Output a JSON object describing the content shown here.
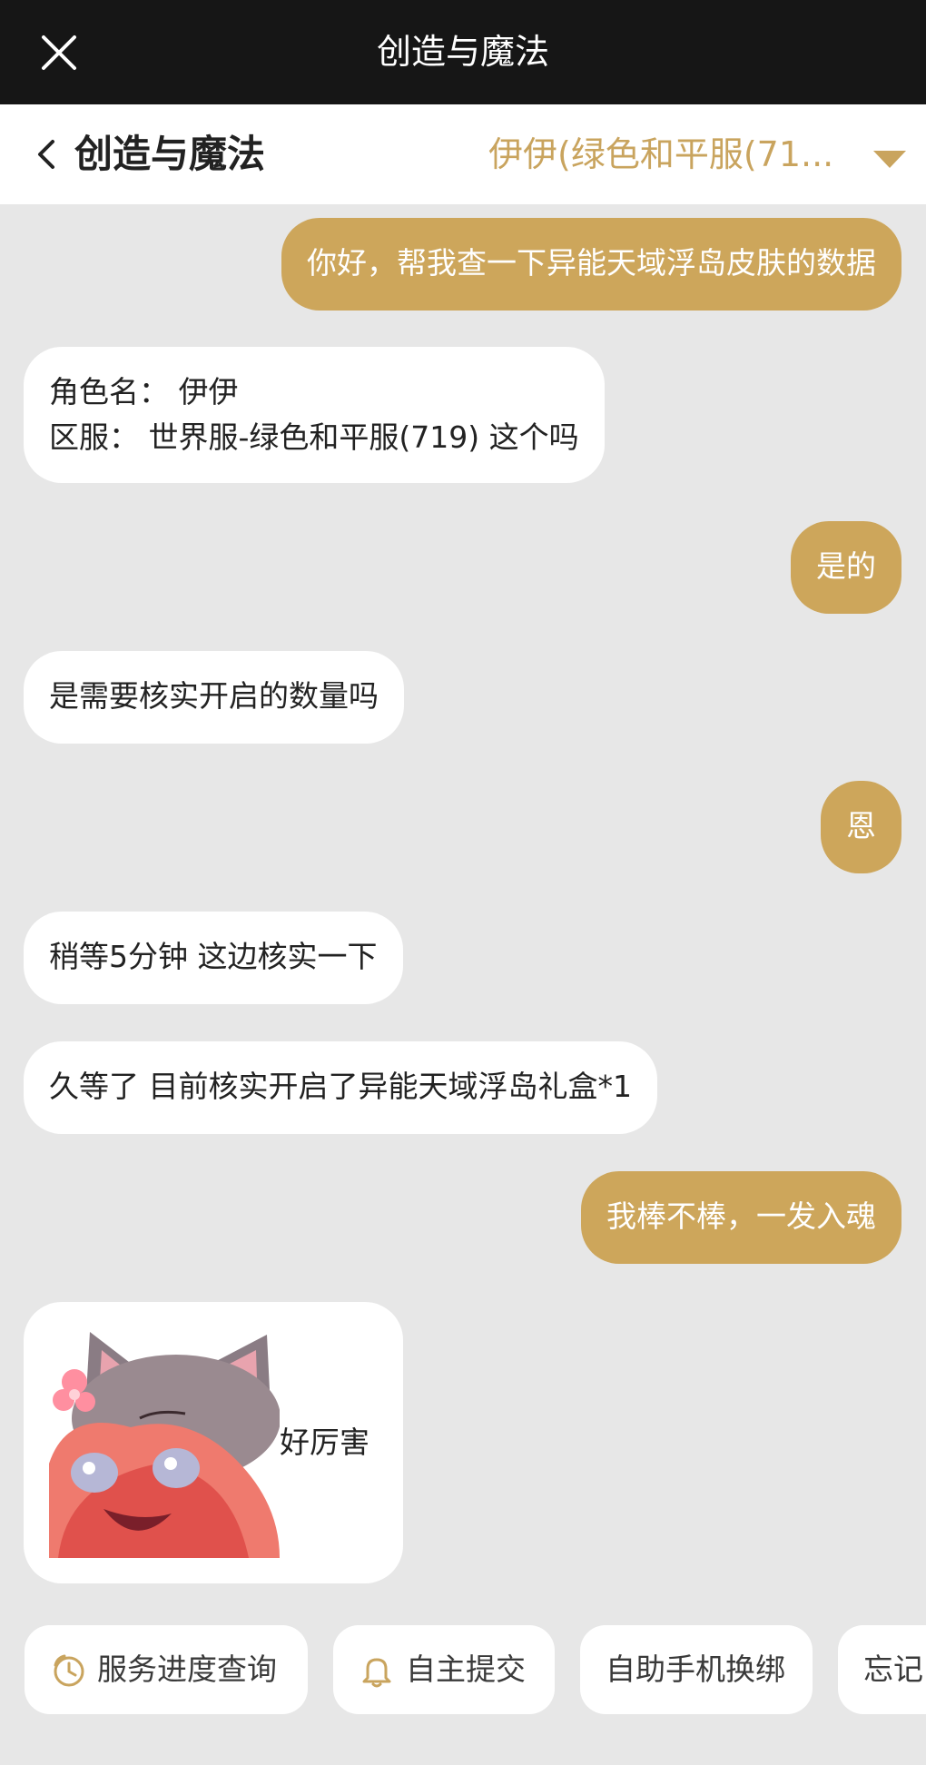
{
  "window": {
    "title": "创造与魔法"
  },
  "header": {
    "title": "创造与魔法",
    "server_selector": "伊伊(绿色和平服(71..."
  },
  "messages": [
    {
      "from": "me",
      "text": "你好，帮我查一下异能天域浮岛皮肤的数据"
    },
    {
      "from": "them",
      "lines": [
        "角色名：  伊伊",
        "区服：  世界服-绿色和平服(719) 这个吗"
      ]
    },
    {
      "from": "me",
      "text": "是的"
    },
    {
      "from": "them",
      "text": "是需要核实开启的数量吗"
    },
    {
      "from": "me",
      "text": "恩"
    },
    {
      "from": "them",
      "text": "稍等5分钟 这边核实一下"
    },
    {
      "from": "them",
      "text": "久等了 目前核实开启了异能天域浮岛礼盒*1"
    },
    {
      "from": "me",
      "text": "我棒不棒，一发入魂"
    },
    {
      "from": "them",
      "text": "好厉害",
      "has_sticker": true
    }
  ],
  "quick_actions": [
    {
      "label": "服务进度查询",
      "icon": "clock-icon"
    },
    {
      "label": "自主提交",
      "icon": "bell-icon"
    },
    {
      "label": "自助手机换绑",
      "icon": ""
    },
    {
      "label": "忘记",
      "icon": ""
    }
  ],
  "colors": {
    "accent": "#cda65b",
    "titlebar": "#161616",
    "chat_bg": "#e7e7e7",
    "server_text": "#c9a45e"
  }
}
